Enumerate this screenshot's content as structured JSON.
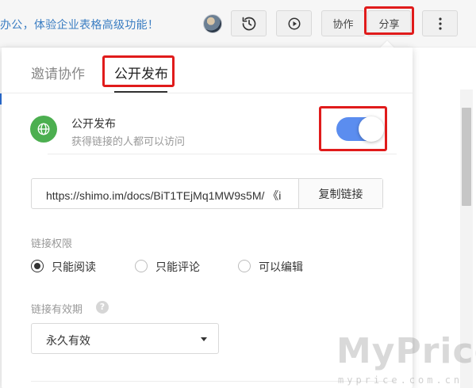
{
  "topbar": {
    "promo_text": "办公，体验企业表格高级功能！",
    "buttons": {
      "history_icon": "history-icon",
      "present_icon": "play-icon",
      "collaborate_label": "协作",
      "share_label": "分享",
      "more_icon": "more-vertical-icon"
    }
  },
  "share_panel": {
    "tabs": [
      {
        "label": "邀请协作",
        "active": false
      },
      {
        "label": "公开发布",
        "active": true
      }
    ],
    "public_publish": {
      "icon": "globe-icon",
      "title": "公开发布",
      "subtitle": "获得链接的人都可以访问",
      "enabled": true
    },
    "link": {
      "url": "https://shimo.im/docs/BiT1TEjMq1MW9s5M/ 《i",
      "copy_label": "复制链接"
    },
    "permissions": {
      "label": "链接权限",
      "options": [
        {
          "label": "只能阅读",
          "checked": true
        },
        {
          "label": "只能评论",
          "checked": false
        },
        {
          "label": "可以编辑",
          "checked": false
        }
      ]
    },
    "validity": {
      "label": "链接有效期",
      "help": "?",
      "selected": "永久有效"
    }
  },
  "watermark": {
    "text": "MyPrice",
    "sub": "myprice.com.cn"
  },
  "colors": {
    "highlight": "#e01b1b",
    "toggle_on": "#5b8def",
    "globe": "#4caf50",
    "promo": "#3a7dc2"
  }
}
